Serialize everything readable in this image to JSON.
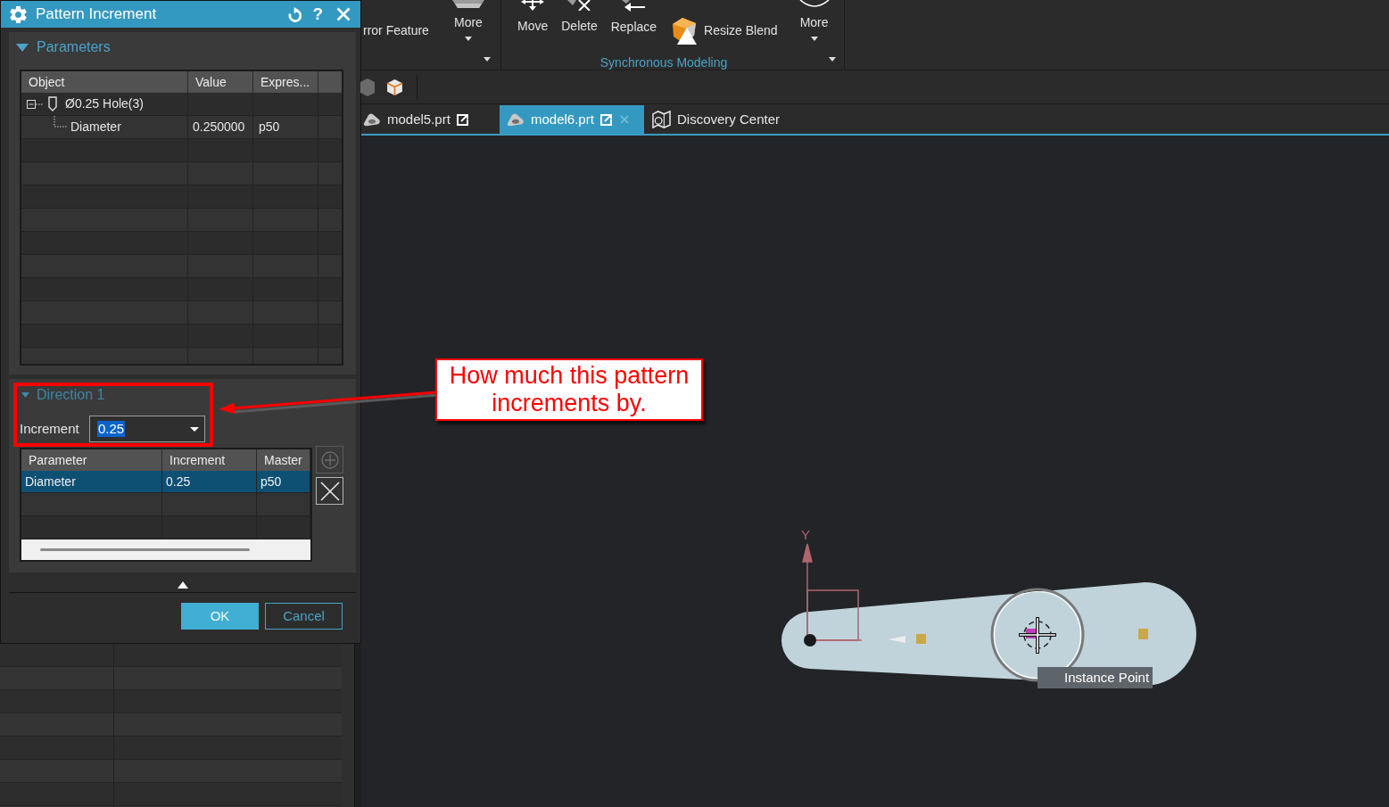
{
  "dialog": {
    "title": "Pattern Increment",
    "title_buttons": [
      {
        "kind": "reset"
      },
      {
        "kind": "help",
        "label": "?"
      },
      {
        "kind": "close"
      }
    ],
    "parameters": {
      "heading": "Parameters",
      "expanded": true,
      "columns": [
        "Object",
        "Value",
        "Expres..."
      ],
      "rows": [
        {
          "label": "Ø0.25 Hole(3)",
          "expanded": true,
          "children": [
            {
              "label": "Diameter",
              "value": "0.250000",
              "expression": "p50"
            }
          ]
        }
      ]
    },
    "direction": {
      "heading": "Direction 1",
      "expanded": true,
      "increment": {
        "label": "Increment",
        "value": "0.25",
        "value_selected": true
      },
      "columns": [
        "Parameter",
        "Increment",
        "Master"
      ],
      "rows": [
        {
          "cells": [
            "Diameter",
            "0.25",
            "p50"
          ],
          "selected": true
        }
      ],
      "side_buttons": [
        {
          "kind": "add",
          "disabled": true
        },
        {
          "kind": "delete",
          "disabled": false
        }
      ]
    },
    "buttons": [
      {
        "label": "OK",
        "kind": "primary"
      },
      {
        "label": "Cancel",
        "kind": "secondary"
      }
    ]
  },
  "ribbon": {
    "groups": [
      {
        "items": [
          {
            "label": "rror Feature",
            "kind": "text"
          },
          {
            "label": "More",
            "kind": "more"
          }
        ]
      },
      {
        "label": "Synchronous Modeling",
        "items": [
          {
            "label": "Move",
            "kind": "move"
          },
          {
            "label": "Delete",
            "kind": "delete"
          },
          {
            "label": "Replace",
            "kind": "replace"
          },
          {
            "label": "Resize Blend",
            "kind": "blend"
          },
          {
            "label": "More",
            "kind": "more"
          }
        ]
      }
    ]
  },
  "tabs": [
    {
      "label": "model5.prt",
      "kind": "part",
      "selected": false,
      "closable": false
    },
    {
      "label": "model6.prt",
      "kind": "part",
      "selected": true,
      "closable": true
    },
    {
      "label": "Discovery Center",
      "kind": "discovery",
      "selected": false,
      "closable": false
    }
  ],
  "viewport": {
    "axis_label": "Y",
    "tooltip": "Instance Point"
  },
  "callout": {
    "text": "How much this pattern increments by."
  }
}
